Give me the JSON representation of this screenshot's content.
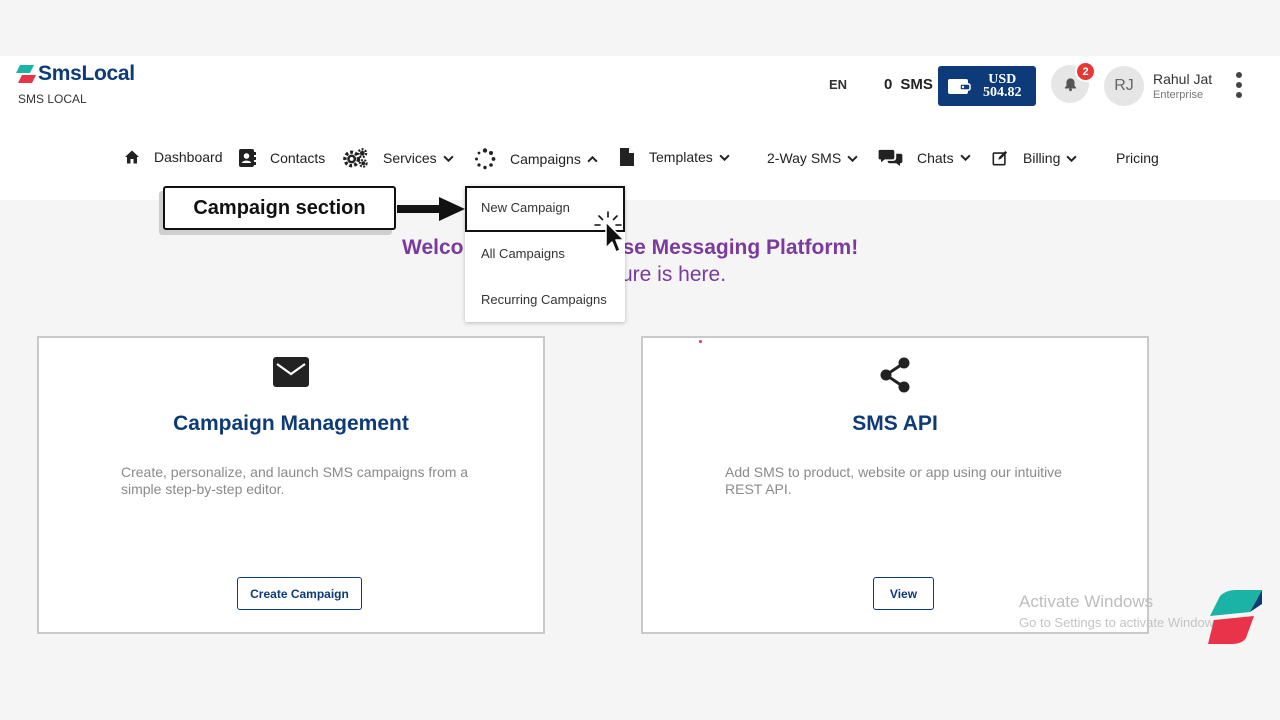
{
  "brand": {
    "name": "SmsLocal",
    "subtitle": "SMS LOCAL",
    "colors": {
      "primary": "#0d3a78",
      "accent_teal": "#1ab3a6",
      "accent_red": "#e8334a",
      "purple": "#7b3a9e"
    }
  },
  "header": {
    "language": "EN",
    "sms_count": "0",
    "sms_label": "SMS",
    "wallet": {
      "currency": "USD",
      "amount": "504.82",
      "icon": "wallet-icon"
    },
    "notifications": {
      "icon": "bell-icon",
      "count": "2"
    },
    "user": {
      "initials": "RJ",
      "name": "Rahul Jat",
      "plan": "Enterprise"
    },
    "menu_icon": "more-vertical-icon"
  },
  "nav": {
    "items": [
      {
        "label": "Dashboard",
        "icon": "home-icon"
      },
      {
        "label": "Contacts",
        "icon": "contacts-icon"
      },
      {
        "label": "Services",
        "icon": "gears-icon",
        "has_dropdown": true
      },
      {
        "label": "Campaigns",
        "icon": "spinner-icon",
        "has_dropdown": true,
        "expanded": true
      },
      {
        "label": "Templates",
        "icon": "file-icon",
        "has_dropdown": true
      },
      {
        "label": "2-Way SMS",
        "has_dropdown": true
      },
      {
        "label": "Chats",
        "icon": "chat-icon",
        "has_dropdown": true
      },
      {
        "label": "Billing",
        "icon": "edit-icon",
        "has_dropdown": true
      },
      {
        "label": "Pricing"
      }
    ]
  },
  "campaigns_dropdown": {
    "items": [
      "New Campaign",
      "All Campaigns",
      "Recurring Campaigns"
    ],
    "highlighted": "New Campaign"
  },
  "callout": {
    "text": "Campaign section"
  },
  "welcome": {
    "line1_start": "Welco",
    "line1_end": "se Messaging Platform!",
    "line2_end": "ure is here."
  },
  "cards": [
    {
      "icon": "envelope-icon",
      "title": "Campaign Management",
      "description": "Create, personalize, and launch SMS campaigns from a simple step-by-step editor.",
      "button": "Create Campaign"
    },
    {
      "icon": "share-icon",
      "title": "SMS API",
      "description": "Add SMS to product, website or app using our intuitive REST API.",
      "button": "View"
    }
  ],
  "watermark": {
    "line1": "Activate Windows",
    "line2": "Go to Settings to activate Windows."
  }
}
